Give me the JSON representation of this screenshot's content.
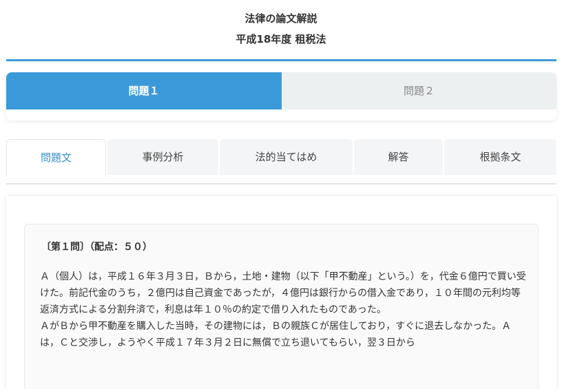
{
  "header": {
    "title": "法律の論文解説",
    "subtitle": "平成18年度 租税法"
  },
  "problem_tabs": [
    {
      "label": "問題１",
      "active": true
    },
    {
      "label": "問題２",
      "active": false
    }
  ],
  "section_tabs": [
    {
      "label": "問題文",
      "active": true
    },
    {
      "label": "事例分析",
      "active": false
    },
    {
      "label": "法的当てはめ",
      "active": false
    },
    {
      "label": "解答",
      "active": false
    },
    {
      "label": "根拠条文",
      "active": false
    }
  ],
  "question": {
    "heading": "〔第１問〕（配点：５０）",
    "paragraphs": [
      "Ａ（個人）は，平成１６年３月３日，Ｂから，土地・建物（以下「甲不動産」という。）を，代金６億円で買い受けた。前記代金のうち，２億円は自己資金であったが，４億円は銀行からの借入金であり，１０年間の元利均等返済方式による分割弁済で，利息は年１０％の約定で借り入れたものであった。",
      "ＡがＢから甲不動産を購入した当時，その建物には，Ｂの親族Ｃが居住しており，すぐに退去しなかった。Ａは，Ｃと交渉し，ようやく平成１７年３月２日に無償で立ち退いてもらい，翌３日から"
    ]
  },
  "colors": {
    "accent": "#3a9ad9",
    "inactive_tab_bg": "#ecf0f1",
    "active_section_text": "#3a8fc8"
  }
}
